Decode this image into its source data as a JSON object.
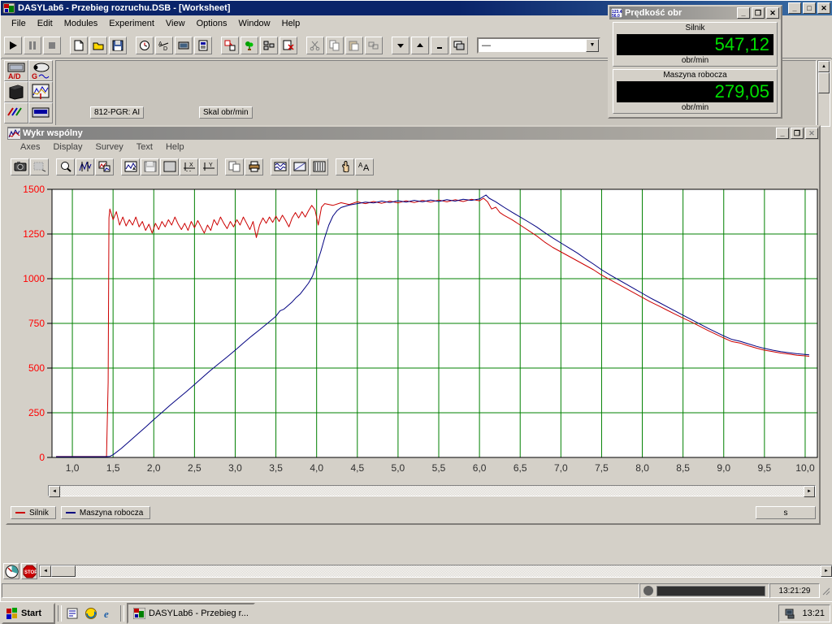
{
  "app": {
    "title": "DASYLab6 - Przebieg rozruchu.DSB - [Worksheet]",
    "icon": "dasylab-icon",
    "menu": [
      "File",
      "Edit",
      "Modules",
      "Experiment",
      "View",
      "Options",
      "Window",
      "Help"
    ],
    "window_buttons": {
      "minimize": "_",
      "maximize": "□",
      "close": "✕"
    },
    "inner_window_buttons": {
      "minimize": "_",
      "restore": "❐",
      "close": "✕"
    },
    "toolbar": {
      "combo_value": "—",
      "buttons": [
        "run-icon",
        "pause-icon",
        "stop-icon",
        "new-document-icon",
        "open-folder-icon",
        "save-disk-icon",
        "clock-icon",
        "ad-converter-icon",
        "display-module-icon",
        "info-module-icon",
        "layout-icon",
        "plant-icon",
        "module-list-icon",
        "module-delete-icon",
        "cut-scissors-icon",
        "copy-icon",
        "paste-icon",
        "arrange-icon",
        "down-arrow-icon",
        "up-arrow-icon",
        "minimize-icon",
        "window-tile-icon"
      ]
    },
    "palette": [
      "ad-input-icon",
      "generator-icon",
      "cube-module-icon",
      "chart-module-icon",
      "signal-icon",
      "display-icon"
    ],
    "worksheet_modules": [
      {
        "label": "812-PGR: AI"
      },
      {
        "label": "Skal obr/min"
      }
    ]
  },
  "chart_window": {
    "title": "Wykr wspólny",
    "icon": "chart-window-icon",
    "menu": [
      "Axes",
      "Display",
      "Survey",
      "Text",
      "Help"
    ],
    "toolbar_buttons": [
      "camera-icon",
      "print-preview-icon",
      "zoom-icon",
      "curve-tool-icon",
      "picture-icon",
      "scroll-view-icon",
      "save-data-icon",
      "grid-dots-icon",
      "x-axis-icon",
      "y-axis-icon",
      "copy-icon",
      "printer-icon",
      "waveform-icon",
      "scatter-icon",
      "bars-icon",
      "hand-pointer-icon",
      "font-icon"
    ],
    "x_unit_label": "s",
    "legend": [
      {
        "label": "Silnik",
        "color": "#cc0000"
      },
      {
        "label": "Maszyna robocza",
        "color": "#000080"
      }
    ]
  },
  "chart_data": {
    "type": "line",
    "title": "Wykr wspólny",
    "xlabel": "s",
    "ylabel": "obr/min",
    "xlim": [
      0.75,
      10.15
    ],
    "ylim": [
      0,
      1500
    ],
    "xticks": [
      "1,0",
      "1,5",
      "2,0",
      "2,5",
      "3,0",
      "3,5",
      "4,0",
      "4,5",
      "5,0",
      "5,5",
      "6,0",
      "6,5",
      "7,0",
      "7,5",
      "8,0",
      "8,5",
      "9,0",
      "9,5",
      "10,0"
    ],
    "yticks": [
      "0",
      "250",
      "500",
      "750",
      "1000",
      "1250",
      "1500"
    ],
    "grid": true,
    "grid_color": "#008000",
    "axis_label_color": "#ff0000",
    "plot_bg": "#ffffff",
    "legend_position": "bottom-left",
    "series": [
      {
        "name": "Silnik",
        "color": "#cc0000",
        "points": [
          [
            0.8,
            5
          ],
          [
            1.0,
            5
          ],
          [
            1.2,
            5
          ],
          [
            1.35,
            5
          ],
          [
            1.42,
            5
          ],
          [
            1.44,
            420
          ],
          [
            1.45,
            1340
          ],
          [
            1.46,
            1390
          ],
          [
            1.5,
            1330
          ],
          [
            1.54,
            1375
          ],
          [
            1.58,
            1300
          ],
          [
            1.62,
            1345
          ],
          [
            1.66,
            1295
          ],
          [
            1.7,
            1330
          ],
          [
            1.74,
            1300
          ],
          [
            1.78,
            1345
          ],
          [
            1.82,
            1290
          ],
          [
            1.86,
            1320
          ],
          [
            1.9,
            1270
          ],
          [
            1.94,
            1305
          ],
          [
            1.98,
            1255
          ],
          [
            2.02,
            1310
          ],
          [
            2.06,
            1275
          ],
          [
            2.1,
            1320
          ],
          [
            2.14,
            1290
          ],
          [
            2.18,
            1330
          ],
          [
            2.22,
            1300
          ],
          [
            2.26,
            1345
          ],
          [
            2.3,
            1305
          ],
          [
            2.34,
            1275
          ],
          [
            2.38,
            1310
          ],
          [
            2.42,
            1270
          ],
          [
            2.46,
            1320
          ],
          [
            2.5,
            1285
          ],
          [
            2.54,
            1325
          ],
          [
            2.58,
            1290
          ],
          [
            2.62,
            1255
          ],
          [
            2.66,
            1300
          ],
          [
            2.7,
            1270
          ],
          [
            2.74,
            1330
          ],
          [
            2.78,
            1300
          ],
          [
            2.82,
            1345
          ],
          [
            2.86,
            1310
          ],
          [
            2.9,
            1280
          ],
          [
            2.94,
            1320
          ],
          [
            2.98,
            1290
          ],
          [
            3.02,
            1330
          ],
          [
            3.06,
            1300
          ],
          [
            3.1,
            1345
          ],
          [
            3.14,
            1310
          ],
          [
            3.18,
            1275
          ],
          [
            3.22,
            1320
          ],
          [
            3.26,
            1230
          ],
          [
            3.3,
            1300
          ],
          [
            3.34,
            1340
          ],
          [
            3.38,
            1310
          ],
          [
            3.42,
            1345
          ],
          [
            3.46,
            1315
          ],
          [
            3.5,
            1350
          ],
          [
            3.54,
            1320
          ],
          [
            3.58,
            1355
          ],
          [
            3.62,
            1325
          ],
          [
            3.66,
            1290
          ],
          [
            3.7,
            1340
          ],
          [
            3.74,
            1370
          ],
          [
            3.78,
            1340
          ],
          [
            3.82,
            1375
          ],
          [
            3.86,
            1345
          ],
          [
            3.9,
            1380
          ],
          [
            3.94,
            1410
          ],
          [
            3.98,
            1385
          ],
          [
            4.02,
            1300
          ],
          [
            4.06,
            1400
          ],
          [
            4.1,
            1420
          ],
          [
            4.2,
            1410
          ],
          [
            4.3,
            1425
          ],
          [
            4.4,
            1415
          ],
          [
            4.5,
            1430
          ],
          [
            4.6,
            1420
          ],
          [
            4.7,
            1432
          ],
          [
            4.8,
            1422
          ],
          [
            4.9,
            1434
          ],
          [
            5.0,
            1424
          ],
          [
            5.1,
            1436
          ],
          [
            5.2,
            1426
          ],
          [
            5.3,
            1438
          ],
          [
            5.4,
            1428
          ],
          [
            5.5,
            1440
          ],
          [
            5.6,
            1430
          ],
          [
            5.7,
            1442
          ],
          [
            5.8,
            1432
          ],
          [
            5.9,
            1444
          ],
          [
            6.0,
            1436
          ],
          [
            6.05,
            1450
          ],
          [
            6.1,
            1430
          ],
          [
            6.15,
            1390
          ],
          [
            6.2,
            1400
          ],
          [
            6.25,
            1370
          ],
          [
            6.3,
            1355
          ],
          [
            6.4,
            1330
          ],
          [
            6.5,
            1300
          ],
          [
            6.6,
            1270
          ],
          [
            6.7,
            1240
          ],
          [
            6.8,
            1205
          ],
          [
            6.9,
            1175
          ],
          [
            7.0,
            1150
          ],
          [
            7.1,
            1125
          ],
          [
            7.2,
            1100
          ],
          [
            7.3,
            1075
          ],
          [
            7.4,
            1050
          ],
          [
            7.5,
            1020
          ],
          [
            7.6,
            995
          ],
          [
            7.7,
            970
          ],
          [
            7.8,
            945
          ],
          [
            7.9,
            920
          ],
          [
            8.0,
            895
          ],
          [
            8.1,
            870
          ],
          [
            8.2,
            848
          ],
          [
            8.3,
            825
          ],
          [
            8.4,
            802
          ],
          [
            8.5,
            780
          ],
          [
            8.6,
            758
          ],
          [
            8.7,
            735
          ],
          [
            8.8,
            712
          ],
          [
            8.9,
            690
          ],
          [
            9.0,
            668
          ],
          [
            9.1,
            648
          ],
          [
            9.2,
            640
          ],
          [
            9.3,
            625
          ],
          [
            9.4,
            612
          ],
          [
            9.5,
            600
          ],
          [
            9.6,
            592
          ],
          [
            9.7,
            584
          ],
          [
            9.8,
            578
          ],
          [
            9.9,
            572
          ],
          [
            10.0,
            568
          ],
          [
            10.05,
            566
          ]
        ]
      },
      {
        "name": "Maszyna robocza",
        "color": "#000080",
        "points": [
          [
            0.8,
            4
          ],
          [
            1.0,
            4
          ],
          [
            1.2,
            4
          ],
          [
            1.4,
            4
          ],
          [
            1.46,
            6
          ],
          [
            1.5,
            15
          ],
          [
            1.6,
            50
          ],
          [
            1.7,
            90
          ],
          [
            1.8,
            130
          ],
          [
            1.9,
            170
          ],
          [
            2.0,
            212
          ],
          [
            2.1,
            252
          ],
          [
            2.2,
            292
          ],
          [
            2.3,
            330
          ],
          [
            2.4,
            368
          ],
          [
            2.5,
            408
          ],
          [
            2.6,
            448
          ],
          [
            2.7,
            488
          ],
          [
            2.8,
            525
          ],
          [
            2.9,
            562
          ],
          [
            3.0,
            600
          ],
          [
            3.1,
            640
          ],
          [
            3.2,
            678
          ],
          [
            3.3,
            714
          ],
          [
            3.4,
            752
          ],
          [
            3.5,
            790
          ],
          [
            3.55,
            820
          ],
          [
            3.6,
            830
          ],
          [
            3.7,
            870
          ],
          [
            3.75,
            895
          ],
          [
            3.8,
            915
          ],
          [
            3.85,
            945
          ],
          [
            3.9,
            975
          ],
          [
            3.95,
            1015
          ],
          [
            4.0,
            1080
          ],
          [
            4.05,
            1150
          ],
          [
            4.1,
            1230
          ],
          [
            4.15,
            1300
          ],
          [
            4.2,
            1350
          ],
          [
            4.25,
            1380
          ],
          [
            4.3,
            1398
          ],
          [
            4.4,
            1412
          ],
          [
            4.5,
            1420
          ],
          [
            4.6,
            1428
          ],
          [
            4.7,
            1424
          ],
          [
            4.8,
            1434
          ],
          [
            4.9,
            1426
          ],
          [
            5.0,
            1436
          ],
          [
            5.1,
            1428
          ],
          [
            5.2,
            1438
          ],
          [
            5.3,
            1430
          ],
          [
            5.4,
            1440
          ],
          [
            5.5,
            1432
          ],
          [
            5.6,
            1442
          ],
          [
            5.7,
            1434
          ],
          [
            5.8,
            1444
          ],
          [
            5.9,
            1438
          ],
          [
            6.0,
            1446
          ],
          [
            6.08,
            1468
          ],
          [
            6.12,
            1450
          ],
          [
            6.2,
            1430
          ],
          [
            6.3,
            1400
          ],
          [
            6.4,
            1372
          ],
          [
            6.5,
            1345
          ],
          [
            6.6,
            1318
          ],
          [
            6.7,
            1290
          ],
          [
            6.8,
            1258
          ],
          [
            6.9,
            1228
          ],
          [
            7.0,
            1200
          ],
          [
            7.1,
            1172
          ],
          [
            7.2,
            1144
          ],
          [
            7.3,
            1112
          ],
          [
            7.4,
            1082
          ],
          [
            7.5,
            1050
          ],
          [
            7.6,
            1022
          ],
          [
            7.7,
            996
          ],
          [
            7.8,
            970
          ],
          [
            7.9,
            944
          ],
          [
            8.0,
            918
          ],
          [
            8.1,
            892
          ],
          [
            8.2,
            868
          ],
          [
            8.3,
            844
          ],
          [
            8.4,
            820
          ],
          [
            8.5,
            796
          ],
          [
            8.6,
            772
          ],
          [
            8.7,
            748
          ],
          [
            8.8,
            724
          ],
          [
            8.9,
            702
          ],
          [
            9.0,
            680
          ],
          [
            9.1,
            660
          ],
          [
            9.2,
            650
          ],
          [
            9.3,
            636
          ],
          [
            9.4,
            622
          ],
          [
            9.5,
            610
          ],
          [
            9.6,
            600
          ],
          [
            9.7,
            592
          ],
          [
            9.8,
            586
          ],
          [
            9.9,
            580
          ],
          [
            10.0,
            576
          ],
          [
            10.05,
            574
          ]
        ]
      }
    ]
  },
  "meter_window": {
    "title": "Prędkość obr",
    "icon": "digital-meter-icon",
    "window_buttons": {
      "minimize": "_",
      "restore": "❐",
      "close": "✕"
    },
    "panels": [
      {
        "label": "Silnik",
        "value": "547,12",
        "unit": "obr/min",
        "color": "#00e000"
      },
      {
        "label": "Maszyna robocza",
        "value": "279,05",
        "unit": "obr/min",
        "color": "#00e000"
      }
    ]
  },
  "status_bar": {
    "time": "13:21:29"
  },
  "taskbar": {
    "start_label": "Start",
    "quick_launch": [
      "show-desktop-icon",
      "explorer-icon",
      "internet-explorer-icon"
    ],
    "tasks": [
      {
        "label": "DASYLab6 - Przebieg r...",
        "icon": "dasylab-icon"
      }
    ],
    "tray_icons": [
      "network-icon"
    ],
    "clock": "13:21"
  }
}
